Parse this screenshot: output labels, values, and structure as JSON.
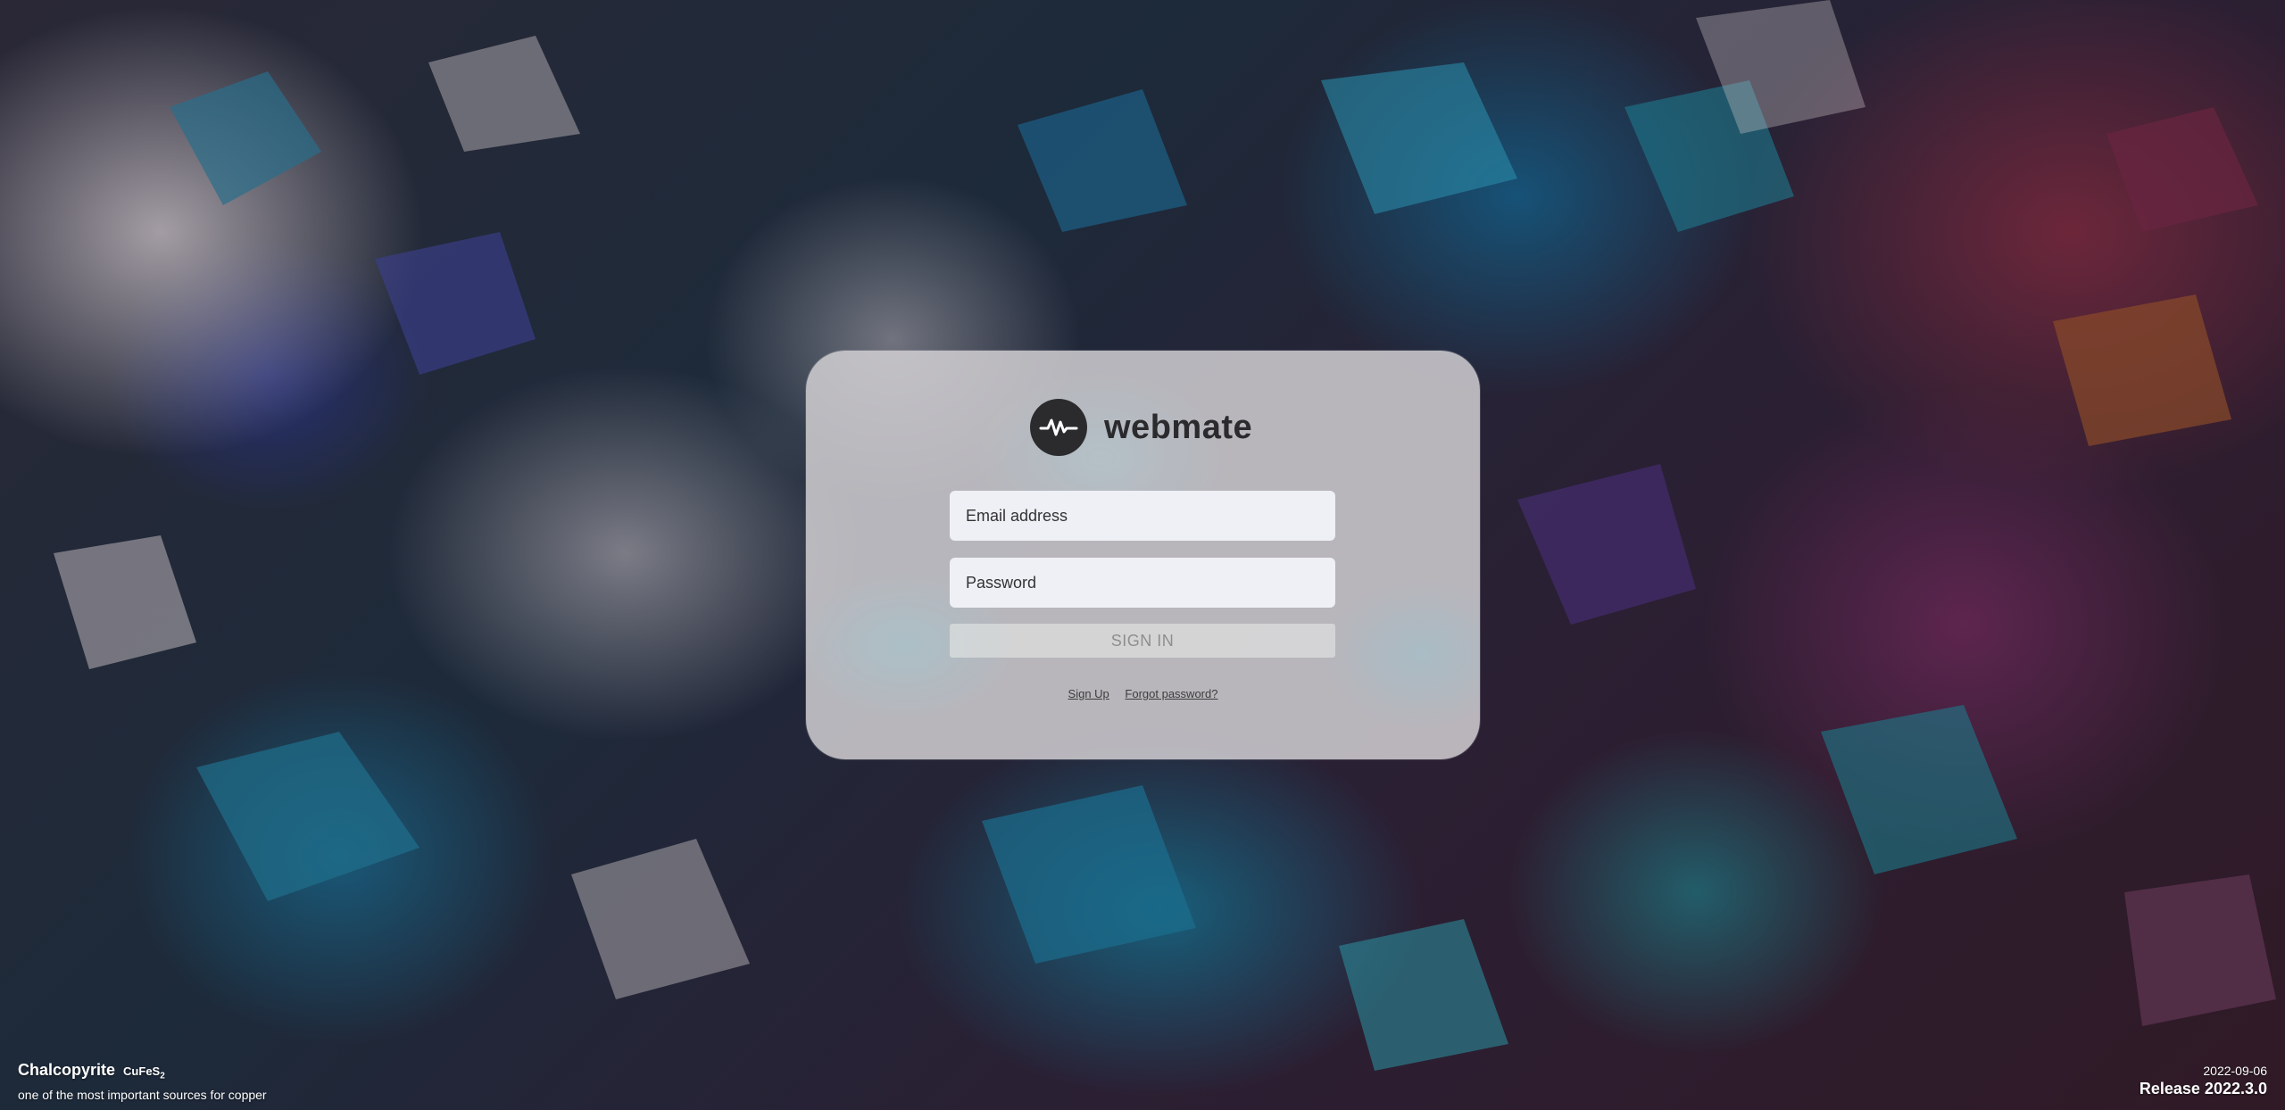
{
  "app": {
    "name": "webmate"
  },
  "login": {
    "email_placeholder": "Email address",
    "password_placeholder": "Password",
    "signin_label": "SIGN IN",
    "signup_link": "Sign Up",
    "forgot_link": "Forgot password?"
  },
  "background_caption": {
    "mineral": "Chalcopyrite",
    "formula_prefix": "CuFeS",
    "formula_subscript": "2",
    "description": "one of the most important sources for copper"
  },
  "release": {
    "date": "2022-09-06",
    "version": "Release 2022.3.0"
  },
  "colors": {
    "card_background": "#d0ced2",
    "logo_dark": "#2b2b2e",
    "input_background": "#eef0f6",
    "signin_disabled_text": "#8e8e8e"
  },
  "icons": {
    "logo": "webmate-wave-logo-icon"
  }
}
